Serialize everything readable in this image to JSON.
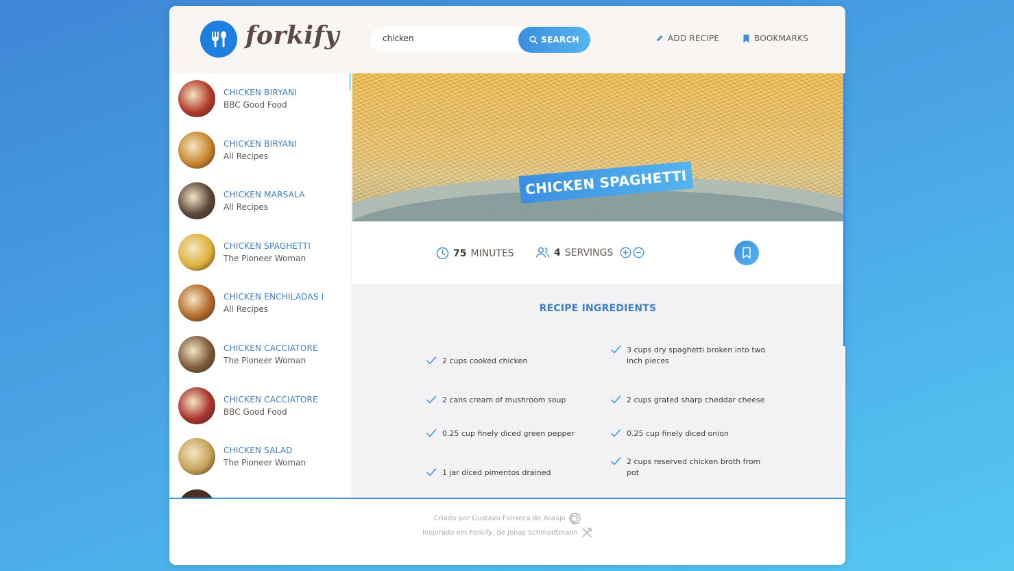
{
  "header": {
    "logo_text": "forkify",
    "search_value": "chicken",
    "search_button": "SEARCH",
    "nav": {
      "add_recipe": "ADD RECIPE",
      "bookmarks": "BOOKMARKS"
    }
  },
  "results": [
    {
      "title": "CHICKEN BIRYANI",
      "publisher": "BBC Good Food",
      "color": "#b23a2a"
    },
    {
      "title": "CHICKEN BIRYANI",
      "publisher": "All Recipes",
      "color": "#c9852c"
    },
    {
      "title": "CHICKEN MARSALA",
      "publisher": "All Recipes",
      "color": "#5a4638"
    },
    {
      "title": "CHICKEN SPAGHETTI",
      "publisher": "The Pioneer Woman",
      "color": "#e0b23c"
    },
    {
      "title": "CHICKEN ENCHILADAS I",
      "publisher": "All Recipes",
      "color": "#b36a2a"
    },
    {
      "title": "CHICKEN CACCIATORE",
      "publisher": "The Pioneer Woman",
      "color": "#7d5a3a"
    },
    {
      "title": "CHICKEN CACCIATORE",
      "publisher": "BBC Good Food",
      "color": "#a8332c"
    },
    {
      "title": "CHICKEN SALAD",
      "publisher": "The Pioneer Woman",
      "color": "#c6a25a"
    }
  ],
  "recipe": {
    "title": "CHICKEN SPAGHETTI",
    "minutes": "75",
    "minutes_label": "MINUTES",
    "servings": "4",
    "servings_label": "SERVINGS",
    "ingredients_heading": "RECIPE INGREDIENTS",
    "ingredients": [
      "2 cups cooked chicken",
      "3 cups dry spaghetti broken into two inch pieces",
      "2 cans cream of mushroom soup",
      "2 cups grated sharp cheddar cheese",
      "0.25 cup finely diced green pepper",
      "0.25 cup finely diced onion",
      "1 jar diced pimentos drained",
      "2 cups reserved chicken broth from pot"
    ]
  },
  "footer": {
    "credit_line1": "Criado por Gustavo Fonseca de Araújo",
    "credit_line2": "Inspirado em Forkify, de Jonas Schmedtmann"
  },
  "colors": {
    "accent": "#3b8ee0",
    "accent_light": "#55b4ef",
    "text_blue": "#3b7fc6",
    "logo_blue": "#1d7fe0"
  },
  "icons": [
    "fork-spoon-icon",
    "search-icon",
    "pencil-icon",
    "bookmark-icon",
    "clock-icon",
    "users-icon",
    "plus-circle-icon",
    "minus-circle-icon",
    "check-icon",
    "github-icon",
    "fork-knife-icon"
  ]
}
